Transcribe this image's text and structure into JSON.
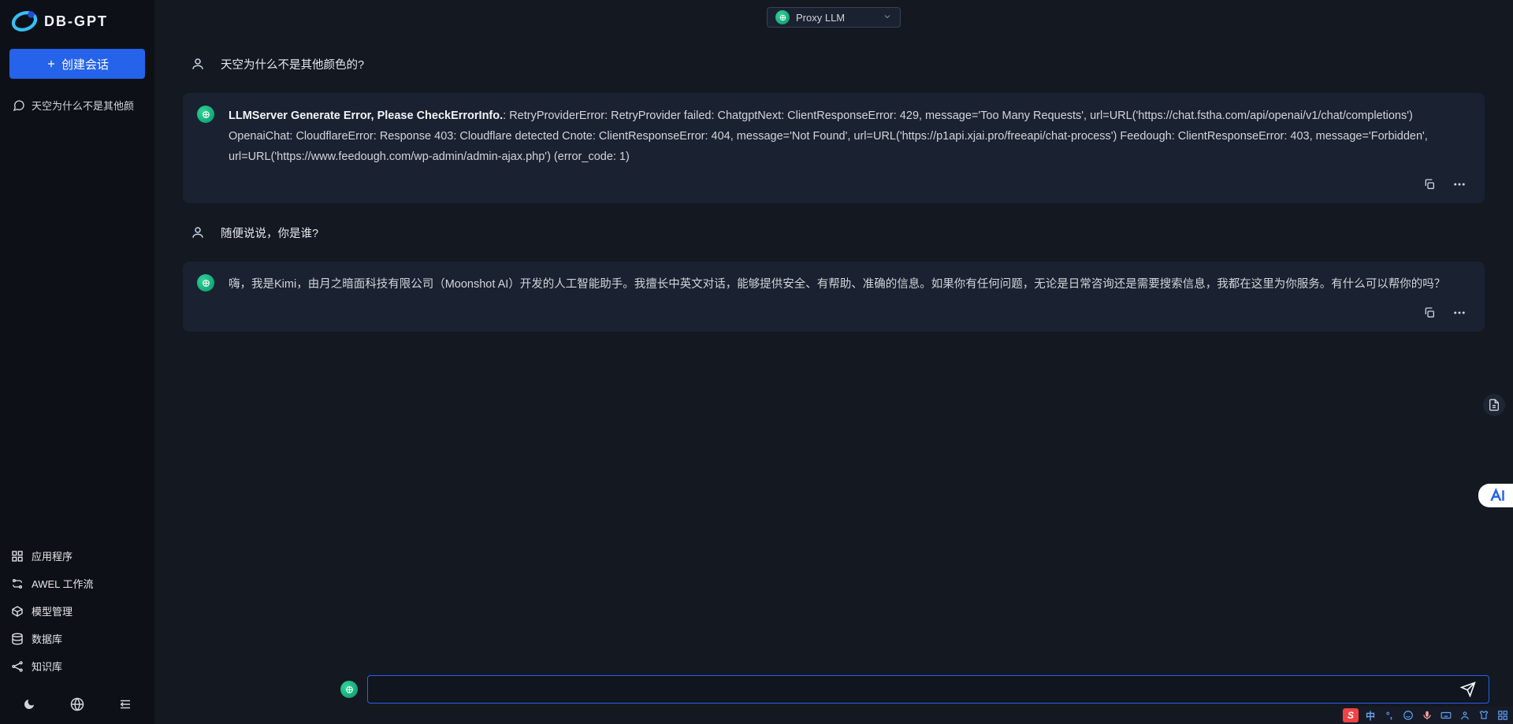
{
  "brand": {
    "name": "DB-GPT"
  },
  "sidebar": {
    "new_chat_label": "创建会话",
    "conversations": [
      {
        "title": "天空为什么不是其他颜"
      }
    ],
    "nav": [
      {
        "label": "应用程序"
      },
      {
        "label": "AWEL 工作流"
      },
      {
        "label": "模型管理"
      },
      {
        "label": "数据库"
      },
      {
        "label": "知识库"
      }
    ]
  },
  "header": {
    "model_selected": "Proxy LLM"
  },
  "chat": {
    "messages": [
      {
        "role": "user",
        "body": {
          "text": "天空为什么不是其他颜色的?"
        }
      },
      {
        "role": "assistant",
        "body": {
          "error_prefix": "LLMServer Generate Error, Please CheckErrorInfo.",
          "error_rest": ": RetryProviderError: RetryProvider failed: ChatgptNext: ClientResponseError: 429, message='Too Many Requests', url=URL('https://chat.fstha.com/api/openai/v1/chat/completions') OpenaiChat: CloudflareError: Response 403: Cloudflare detected Cnote: ClientResponseError: 404, message='Not Found', url=URL('https://p1api.xjai.pro/freeapi/chat-process') Feedough: ClientResponseError: 403, message='Forbidden', url=URL('https://www.feedough.com/wp-admin/admin-ajax.php') (error_code: 1)"
        }
      },
      {
        "role": "user",
        "body": {
          "text": "随便说说，你是谁?"
        }
      },
      {
        "role": "assistant",
        "body": {
          "text": "嗨，我是Kimi，由月之暗面科技有限公司（Moonshot AI）开发的人工智能助手。我擅长中英文对话，能够提供安全、有帮助、准确的信息。如果你有任何问题，无论是日常咨询还是需要搜索信息，我都在这里为你服务。有什么可以帮你的吗？"
        }
      }
    ]
  },
  "input": {
    "value": "",
    "placeholder": ""
  },
  "ime": {
    "brand": "S",
    "lang": "中"
  }
}
